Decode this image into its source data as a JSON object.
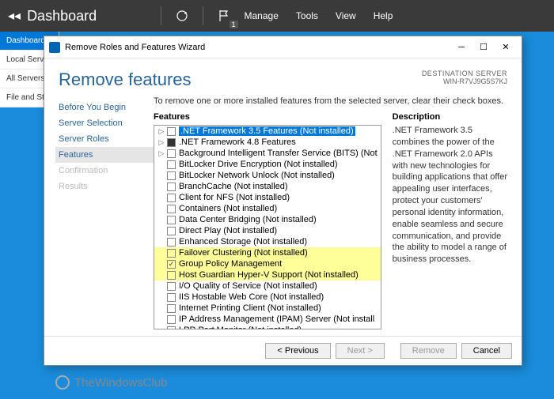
{
  "topbar": {
    "title": "Dashboard",
    "flag_badge": "1",
    "menus": [
      "Manage",
      "Tools",
      "View",
      "Help"
    ]
  },
  "sidebar": {
    "items": [
      "Dashboard",
      "Local Serv",
      "All Servers",
      "File and St"
    ]
  },
  "wizard": {
    "title": "Remove Roles and Features Wizard",
    "heading": "Remove features",
    "destination_label": "DESTINATION SERVER",
    "destination_value": "WIN-R7VJ9G5S7KJ",
    "instruction": "To remove one or more installed features from the selected server, clear their check boxes.",
    "steps": [
      {
        "label": "Before You Begin",
        "state": "normal"
      },
      {
        "label": "Server Selection",
        "state": "normal"
      },
      {
        "label": "Server Roles",
        "state": "normal"
      },
      {
        "label": "Features",
        "state": "current"
      },
      {
        "label": "Confirmation",
        "state": "disabled"
      },
      {
        "label": "Results",
        "state": "disabled"
      }
    ],
    "features_title": "Features",
    "description_title": "Description",
    "description_text": ".NET Framework 3.5 combines the power of the .NET Framework 2.0 APIs with new technologies for building applications that offer appealing user interfaces, protect your customers' personal identity information, enable seamless and secure communication, and provide the ability to model a range of business processes.",
    "features": [
      {
        "label": ".NET Framework 3.5 Features (Not installed)",
        "expandable": true,
        "cb": "empty",
        "selected": true
      },
      {
        "label": ".NET Framework 4.8 Features",
        "expandable": true,
        "cb": "filled"
      },
      {
        "label": "Background Intelligent Transfer Service (BITS) (Not",
        "expandable": true,
        "cb": "empty"
      },
      {
        "label": "BitLocker Drive Encryption (Not installed)",
        "expandable": false,
        "cb": "empty"
      },
      {
        "label": "BitLocker Network Unlock (Not installed)",
        "expandable": false,
        "cb": "empty"
      },
      {
        "label": "BranchCache (Not installed)",
        "expandable": false,
        "cb": "empty"
      },
      {
        "label": "Client for NFS (Not installed)",
        "expandable": false,
        "cb": "empty"
      },
      {
        "label": "Containers (Not installed)",
        "expandable": false,
        "cb": "empty"
      },
      {
        "label": "Data Center Bridging (Not installed)",
        "expandable": false,
        "cb": "empty"
      },
      {
        "label": "Direct Play (Not installed)",
        "expandable": false,
        "cb": "empty"
      },
      {
        "label": "Enhanced Storage (Not installed)",
        "expandable": false,
        "cb": "empty"
      },
      {
        "label": "Failover Clustering (Not installed)",
        "expandable": false,
        "cb": "empty",
        "hl": true
      },
      {
        "label": "Group Policy Management",
        "expandable": false,
        "cb": "checked",
        "hl": true
      },
      {
        "label": "Host Guardian Hyper-V Support (Not installed)",
        "expandable": false,
        "cb": "empty",
        "hl": true
      },
      {
        "label": "I/O Quality of Service (Not installed)",
        "expandable": false,
        "cb": "empty"
      },
      {
        "label": "IIS Hostable Web Core (Not installed)",
        "expandable": false,
        "cb": "empty"
      },
      {
        "label": "Internet Printing Client (Not installed)",
        "expandable": false,
        "cb": "empty"
      },
      {
        "label": "IP Address Management (IPAM) Server (Not install",
        "expandable": false,
        "cb": "empty"
      },
      {
        "label": "LPR Port Monitor (Not installed)",
        "expandable": false,
        "cb": "empty"
      }
    ],
    "buttons": {
      "previous": "< Previous",
      "next": "Next >",
      "remove": "Remove",
      "cancel": "Cancel"
    }
  },
  "watermark": "TheWindowsClub"
}
